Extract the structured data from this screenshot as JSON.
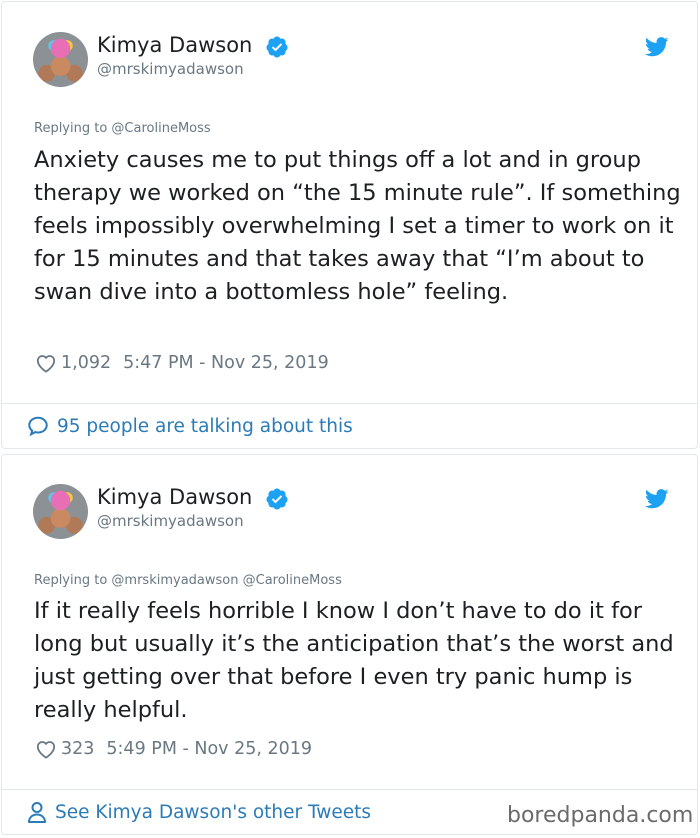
{
  "colors": {
    "link": "#2b7bb9",
    "verified": "#1da1f2",
    "muted": "#697882",
    "text": "#1c2022",
    "border": "#e1e8ed"
  },
  "tweets": [
    {
      "author_name": "Kimya Dawson",
      "author_handle": "@mrskimyadawson",
      "replying_to": "Replying to @CarolineMoss",
      "text": "Anxiety causes me to put things off a lot and in group therapy we worked on “the 15 minute rule”. If something feels impossibly overwhelming I set a timer to work on it for 15 minutes and that takes away that “I’m about to swan dive into a bottomless hole” feeling.",
      "likes": "1,092",
      "timestamp": "5:47 PM - Nov 25, 2019",
      "footer": "95 people are talking about this"
    },
    {
      "author_name": "Kimya Dawson",
      "author_handle": "@mrskimyadawson",
      "replying_to": "Replying to @mrskimyadawson @CarolineMoss",
      "text": "If it really feels horrible I know I don’t have to do it for long but usually it’s the anticipation that’s the worst and just getting over that before I even try panic hump is really helpful.",
      "likes": "323",
      "timestamp": "5:49 PM - Nov 25, 2019",
      "footer": "See Kimya Dawson's other Tweets"
    }
  ],
  "watermark": "boredpanda.com",
  "icons": [
    "verified-badge-icon",
    "twitter-bird-icon",
    "heart-icon",
    "speech-bubble-icon",
    "person-icon"
  ]
}
